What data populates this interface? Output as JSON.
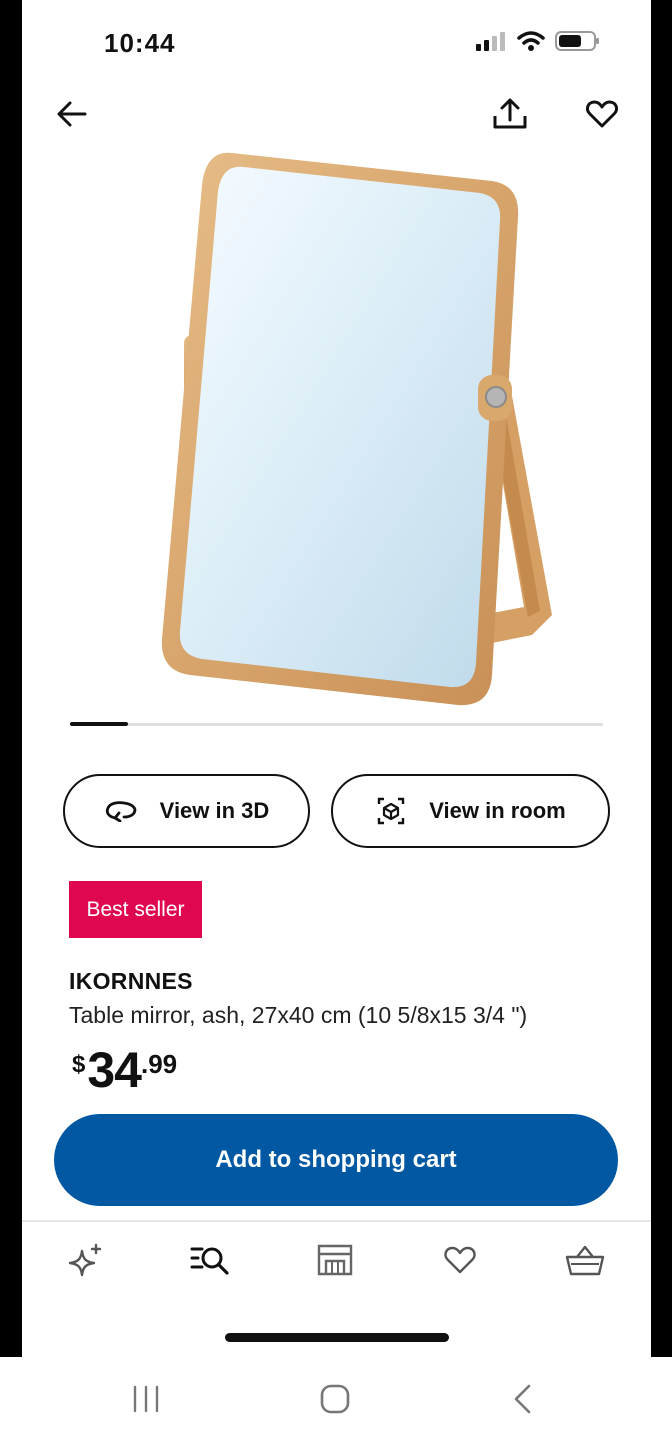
{
  "status_bar": {
    "time": "10:44"
  },
  "header": {
    "back_icon": "arrow-left-icon",
    "share_icon": "share-icon",
    "favorite_icon": "heart-icon"
  },
  "gallery": {
    "current_slide": 1
  },
  "actions": {
    "view_3d_label": "View in 3D",
    "view_room_label": "View in room"
  },
  "product": {
    "badge": "Best seller",
    "name": "IKORNNES",
    "description": "Table mirror, ash, 27x40 cm (10 5/8x15 3/4 \")",
    "price": {
      "currency": "$",
      "integer": "34",
      "decimal": ".99"
    }
  },
  "cart_button": {
    "label": "Add to shopping cart"
  },
  "tabbar": {
    "items": [
      {
        "icon": "sparkle-icon"
      },
      {
        "icon": "search-list-icon"
      },
      {
        "icon": "store-icon"
      },
      {
        "icon": "heart-icon"
      },
      {
        "icon": "basket-icon"
      }
    ]
  },
  "colors": {
    "brand_blue": "#0058a3",
    "badge_red": "#e00751"
  }
}
